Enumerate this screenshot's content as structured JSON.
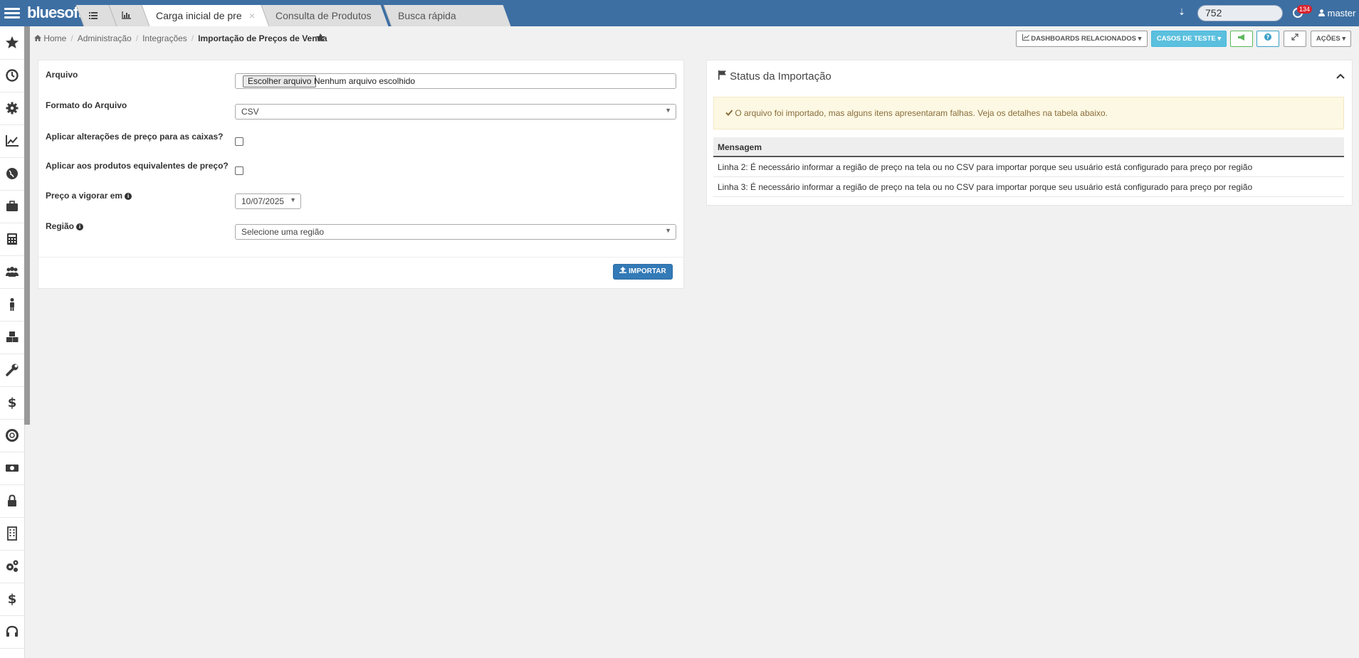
{
  "app": {
    "logo": "bluesoft",
    "quick_search_value": "752",
    "notification_count": "134",
    "user_name": "master"
  },
  "tabs": [
    {
      "label": "Carga inicial de preços",
      "close": "×"
    },
    {
      "label": "Consulta de Produtos"
    },
    {
      "label": "Busca rápida"
    }
  ],
  "sidebar": {
    "items": [
      "star-icon",
      "clock-icon",
      "gear-icon",
      "chart-line-icon",
      "globe-icon",
      "briefcase-icon",
      "calculator-icon",
      "users-icon",
      "person-icon",
      "cubes-icon",
      "wrench-icon",
      "dollar-icon",
      "support-icon",
      "money-icon",
      "lock-icon",
      "building-icon",
      "gears-icon",
      "dollar-icon",
      "headphones-icon"
    ]
  },
  "breadcrumb": {
    "home": "Home",
    "level1": "Administração",
    "level2": "Integrações",
    "current": "Importação de Preços de Venda"
  },
  "header_buttons": {
    "dashboards": "DASHBOARDS RELACIONADOS",
    "test_cases": "CASOS DE TESTE",
    "actions": "AÇÕES"
  },
  "form": {
    "file_label": "Arquivo",
    "file_button": "Escolher arquivo",
    "file_status": "Nenhum arquivo escolhido",
    "format_label": "Formato do Arquivo",
    "format_value": "CSV",
    "apply_boxes_label": "Aplicar alterações de preço para as caixas?",
    "apply_equivalents_label": "Aplicar aos produtos equivalentes de preço?",
    "effective_date_label": "Preço a vigorar em",
    "effective_date_value": "10/07/2025",
    "region_label": "Região",
    "region_placeholder": "Selecione uma região",
    "import_button": "IMPORTAR"
  },
  "status": {
    "title": "Status da Importação",
    "alert": "O arquivo foi importado, mas alguns itens apresentaram falhas. Veja os detalhes na tabela abaixo.",
    "column_header": "Mensagem",
    "rows": [
      "Linha 2: É necessário informar a região de preço na tela ou no CSV para importar porque seu usuário está configurado para preço por região",
      "Linha 3: É necessário informar a região de preço na tela ou no CSV para importar porque seu usuário está configurado para preço por região"
    ]
  },
  "colors": {
    "topbar": "#3d6fa3",
    "primary": "#337ab7",
    "teal": "#5bc0de",
    "alert_bg": "#fcf8e3",
    "alert_text": "#8a6d3b"
  }
}
